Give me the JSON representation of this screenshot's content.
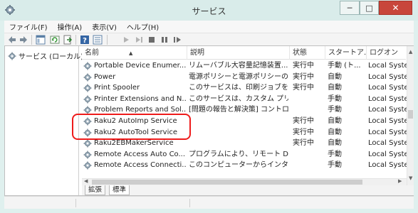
{
  "window": {
    "title": "サービス",
    "minimize_glyph": "─",
    "maximize_glyph": "□",
    "close_glyph": "✕",
    "accent_close_color": "#c8463b"
  },
  "menu": [
    "ファイル(F)",
    "操作(A)",
    "表示(V)",
    "ヘルプ(H)"
  ],
  "toolbar": {
    "icons": [
      "back-icon",
      "forward-icon",
      "show-tree-icon",
      "refresh-icon",
      "export-icon",
      "help-icon",
      "start-icon",
      "start-alt-icon",
      "stop-icon",
      "pause-icon",
      "restart-icon"
    ]
  },
  "tree": {
    "root_label": "サービス (ローカル)"
  },
  "table": {
    "columns": [
      "名前",
      "説明",
      "状態",
      "スタートア...",
      "ログオン"
    ],
    "rows": [
      {
        "name": "Portable Device Enumer...",
        "desc": "リムーバブル大容量記憶装置...",
        "status": "実行中",
        "startup": "手動 (ト...",
        "logon": "Local Syste"
      },
      {
        "name": "Power",
        "desc": "電源ポリシーと電源ポリシーの...",
        "status": "実行中",
        "startup": "自動",
        "logon": "Local Syste"
      },
      {
        "name": "Print Spooler",
        "desc": "このサービスは、印刷ジョブをスプ...",
        "status": "実行中",
        "startup": "自動",
        "logon": "Local Syste"
      },
      {
        "name": "Printer Extensions and N...",
        "desc": "このサービスは、カスタム プリンタ...",
        "status": "",
        "startup": "手動",
        "logon": "Local Syste"
      },
      {
        "name": "Problem Reports and Sol...",
        "desc": "[問題の報告と解決策] コントロ...",
        "status": "",
        "startup": "手動",
        "logon": "Local Syste"
      },
      {
        "name": "Raku2 AutoImp Service",
        "desc": "",
        "status": "実行中",
        "startup": "自動",
        "logon": "Local Syste"
      },
      {
        "name": "Raku2 AutoTool Service",
        "desc": "",
        "status": "実行中",
        "startup": "自動",
        "logon": "Local Syste"
      },
      {
        "name": "Raku2EBMakerService",
        "desc": "",
        "status": "実行中",
        "startup": "自動",
        "logon": "Local Syste"
      },
      {
        "name": "Remote Access Auto Co...",
        "desc": "プログラムにより、リモート DNS ...",
        "status": "",
        "startup": "手動",
        "logon": "Local Syste"
      },
      {
        "name": "Remote Access Connecti...",
        "desc": "このコンピューターからインターネ...",
        "status": "",
        "startup": "手動",
        "logon": "Local Syste"
      }
    ]
  },
  "tabs": [
    "拡張",
    "標準"
  ],
  "highlight_color": "#ee1b1b"
}
